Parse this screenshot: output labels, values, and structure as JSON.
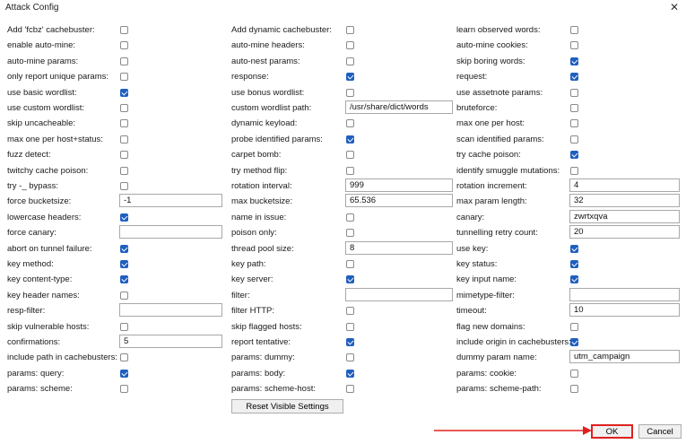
{
  "window": {
    "title": "Attack Config",
    "close_glyph": "✕"
  },
  "columns": [
    [
      {
        "label": "Add 'fcbz' cachebuster:",
        "type": "checkbox",
        "checked": false
      },
      {
        "label": "enable auto-mine:",
        "type": "checkbox",
        "checked": false
      },
      {
        "label": "auto-mine params:",
        "type": "checkbox",
        "checked": false
      },
      {
        "label": "only report unique params:",
        "type": "checkbox",
        "checked": false
      },
      {
        "label": "use basic wordlist:",
        "type": "checkbox",
        "checked": true
      },
      {
        "label": "use custom wordlist:",
        "type": "checkbox",
        "checked": false
      },
      {
        "label": "skip uncacheable:",
        "type": "checkbox",
        "checked": false
      },
      {
        "label": "max one per host+status:",
        "type": "checkbox",
        "checked": false
      },
      {
        "label": "fuzz detect:",
        "type": "checkbox",
        "checked": false
      },
      {
        "label": "twitchy cache poison:",
        "type": "checkbox",
        "checked": false
      },
      {
        "label": "try -_ bypass:",
        "type": "checkbox",
        "checked": false
      },
      {
        "label": "force bucketsize:",
        "type": "text",
        "value": "-1"
      },
      {
        "label": "lowercase headers:",
        "type": "checkbox",
        "checked": true
      },
      {
        "label": "force canary:",
        "type": "text",
        "value": ""
      },
      {
        "label": "abort on tunnel failure:",
        "type": "checkbox",
        "checked": true
      },
      {
        "label": "key method:",
        "type": "checkbox",
        "checked": true
      },
      {
        "label": "key content-type:",
        "type": "checkbox",
        "checked": true
      },
      {
        "label": "key header names:",
        "type": "checkbox",
        "checked": false
      },
      {
        "label": "resp-filter:",
        "type": "text",
        "value": ""
      },
      {
        "label": "skip vulnerable hosts:",
        "type": "checkbox",
        "checked": false
      },
      {
        "label": "confirmations:",
        "type": "text",
        "value": "5"
      },
      {
        "label": "include path in cachebusters:",
        "type": "checkbox",
        "checked": false
      },
      {
        "label": "params: query:",
        "type": "checkbox",
        "checked": true
      },
      {
        "label": "params: scheme:",
        "type": "checkbox",
        "checked": false
      }
    ],
    [
      {
        "label": "Add dynamic cachebuster:",
        "type": "checkbox",
        "checked": false
      },
      {
        "label": "auto-mine headers:",
        "type": "checkbox",
        "checked": false
      },
      {
        "label": "auto-nest params:",
        "type": "checkbox",
        "checked": false
      },
      {
        "label": "response:",
        "type": "checkbox",
        "checked": true
      },
      {
        "label": "use bonus wordlist:",
        "type": "checkbox",
        "checked": false
      },
      {
        "label": "custom wordlist path:",
        "type": "text",
        "value": "/usr/share/dict/words"
      },
      {
        "label": "dynamic keyload:",
        "type": "checkbox",
        "checked": false
      },
      {
        "label": "probe identified params:",
        "type": "checkbox",
        "checked": true
      },
      {
        "label": "carpet bomb:",
        "type": "checkbox",
        "checked": false
      },
      {
        "label": "try method flip:",
        "type": "checkbox",
        "checked": false
      },
      {
        "label": "rotation interval:",
        "type": "text",
        "value": "999"
      },
      {
        "label": "max bucketsize:",
        "type": "text",
        "value": "65.536"
      },
      {
        "label": "name in issue:",
        "type": "checkbox",
        "checked": false
      },
      {
        "label": "poison only:",
        "type": "checkbox",
        "checked": false
      },
      {
        "label": "thread pool size:",
        "type": "text",
        "value": "8"
      },
      {
        "label": "key path:",
        "type": "checkbox",
        "checked": false
      },
      {
        "label": "key server:",
        "type": "checkbox",
        "checked": true
      },
      {
        "label": "filter:",
        "type": "text",
        "value": ""
      },
      {
        "label": "filter HTTP:",
        "type": "checkbox",
        "checked": false
      },
      {
        "label": "skip flagged hosts:",
        "type": "checkbox",
        "checked": false
      },
      {
        "label": "report tentative:",
        "type": "checkbox",
        "checked": true
      },
      {
        "label": "params: dummy:",
        "type": "checkbox",
        "checked": false
      },
      {
        "label": "params: body:",
        "type": "checkbox",
        "checked": true
      },
      {
        "label": "params: scheme-host:",
        "type": "checkbox",
        "checked": false
      }
    ],
    [
      {
        "label": "learn observed words:",
        "type": "checkbox",
        "checked": false
      },
      {
        "label": "auto-mine cookies:",
        "type": "checkbox",
        "checked": false
      },
      {
        "label": "skip boring words:",
        "type": "checkbox",
        "checked": true
      },
      {
        "label": "request:",
        "type": "checkbox",
        "checked": true
      },
      {
        "label": "use assetnote params:",
        "type": "checkbox",
        "checked": false
      },
      {
        "label": "bruteforce:",
        "type": "checkbox",
        "checked": false
      },
      {
        "label": "max one per host:",
        "type": "checkbox",
        "checked": false
      },
      {
        "label": "scan identified params:",
        "type": "checkbox",
        "checked": false
      },
      {
        "label": "try cache poison:",
        "type": "checkbox",
        "checked": true
      },
      {
        "label": "identify smuggle mutations:",
        "type": "checkbox",
        "checked": false
      },
      {
        "label": "rotation increment:",
        "type": "text",
        "value": "4"
      },
      {
        "label": "max param length:",
        "type": "text",
        "value": "32"
      },
      {
        "label": "canary:",
        "type": "text",
        "value": "zwrtxqva"
      },
      {
        "label": "tunnelling retry count:",
        "type": "text",
        "value": "20"
      },
      {
        "label": "use key:",
        "type": "checkbox",
        "checked": true
      },
      {
        "label": "key status:",
        "type": "checkbox",
        "checked": true
      },
      {
        "label": "key input name:",
        "type": "checkbox",
        "checked": true
      },
      {
        "label": "mimetype-filter:",
        "type": "text",
        "value": ""
      },
      {
        "label": "timeout:",
        "type": "text",
        "value": "10"
      },
      {
        "label": "flag new domains:",
        "type": "checkbox",
        "checked": false
      },
      {
        "label": "include origin in cachebusters:",
        "type": "checkbox",
        "checked": true
      },
      {
        "label": "dummy param name:",
        "type": "text",
        "value": "utm_campaign"
      },
      {
        "label": "params: cookie:",
        "type": "checkbox",
        "checked": false
      },
      {
        "label": "params: scheme-path:",
        "type": "checkbox",
        "checked": false
      }
    ]
  ],
  "buttons": {
    "reset": "Reset Visible Settings",
    "ok": "OK",
    "cancel": "Cancel"
  },
  "colors": {
    "checked": "#1f5fbf",
    "highlight": "#e02020"
  }
}
